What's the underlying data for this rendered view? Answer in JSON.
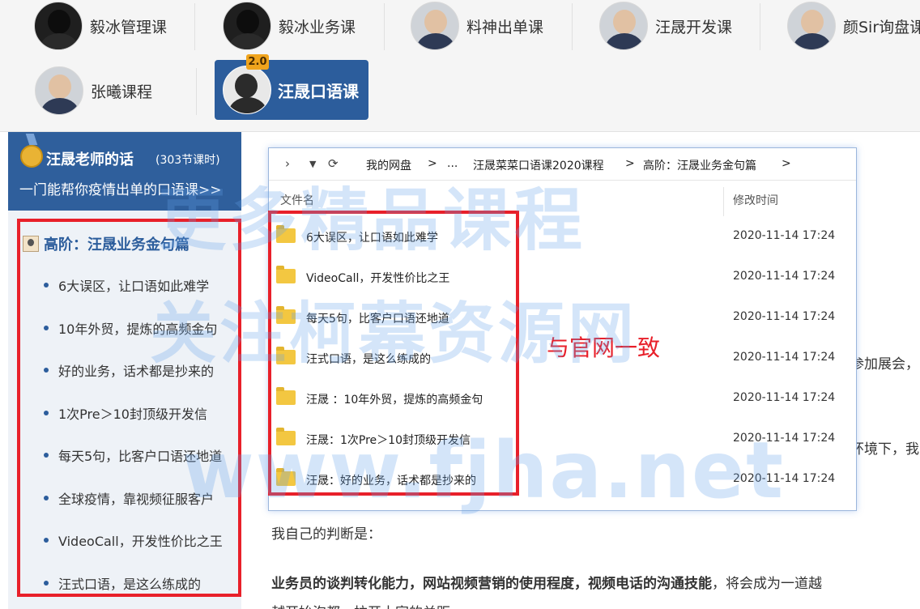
{
  "tabs": [
    {
      "label": "毅冰管理课",
      "icon": "person-avatar-icon"
    },
    {
      "label": "毅冰业务课",
      "icon": "person-avatar-icon"
    },
    {
      "label": "料神出单课",
      "icon": "person-avatar-icon"
    },
    {
      "label": "汪晟开发课",
      "icon": "person-avatar-icon"
    },
    {
      "label": "颜Sir询盘课",
      "icon": "person-avatar-icon"
    },
    {
      "label": "张曦课程",
      "icon": "person-avatar-icon"
    },
    {
      "label": "汪晟口语课",
      "icon": "person-avatar-icon",
      "badge": "2.0",
      "active": true
    }
  ],
  "sidebar": {
    "title": "汪晟老师的话",
    "count": "(303节课时)",
    "subtitle": "一门能帮你疫情出单的口语课>>",
    "section_title": "高阶：汪晟业务金句篇",
    "items": [
      "6大误区，让口语如此难学",
      "10年外贸，提炼的高频金句",
      "好的业务，话术都是抄来的",
      "1次Pre＞10封顶级开发信",
      "每天5句，比客户口语还地道",
      "全球疫情，靠视频征服客户",
      "VideoCall，开发性价比之王",
      "汪式口语，是这么练成的"
    ]
  },
  "explorer": {
    "breadcrumb": [
      "我的网盘",
      ">",
      "...",
      "汪晟菜菜口语课2020课程",
      ">",
      "高阶：汪晟业务金句篇",
      ">"
    ],
    "col_name": "文件名",
    "col_date": "修改时间",
    "rows": [
      {
        "name": "6大误区，让口语如此难学",
        "date": "2020-11-14 17:24"
      },
      {
        "name": "VideoCall，开发性价比之王",
        "date": "2020-11-14 17:24"
      },
      {
        "name": "每天5句，比客户口语还地道",
        "date": "2020-11-14 17:24"
      },
      {
        "name": "汪式口语，是这么练成的",
        "date": "2020-11-14 17:24"
      },
      {
        "name": "汪晟 ：10年外贸，提炼的高频金句",
        "date": "2020-11-14 17:24"
      },
      {
        "name": "汪晟：1次Pre＞10封顶级开发信",
        "date": "2020-11-14 17:24"
      },
      {
        "name": "汪晟：好的业务，话术都是抄来的",
        "date": "2020-11-14 17:24"
      }
    ]
  },
  "annotation": "与官网一致",
  "article": {
    "frag1": "参加展会，",
    "frag2": "环境下，我",
    "p1": "我自己的判断是：",
    "p2_bold": "业务员的谈判转化能力，网站视频营销的使用程度，视频电话的沟通技能",
    "p2_rest": "，将会成为一道越",
    "p3": "越开始泡都，拉开士家的关距"
  },
  "watermark": {
    "line1": "更多精品课程",
    "line2": "关注柯幕资源网",
    "line3": "www.fjha.net"
  },
  "colors": {
    "accent_blue": "#2c5d9c",
    "highlight_red": "#e8202a",
    "badge_orange": "#f0a41d",
    "folder_yellow": "#f3c741"
  }
}
